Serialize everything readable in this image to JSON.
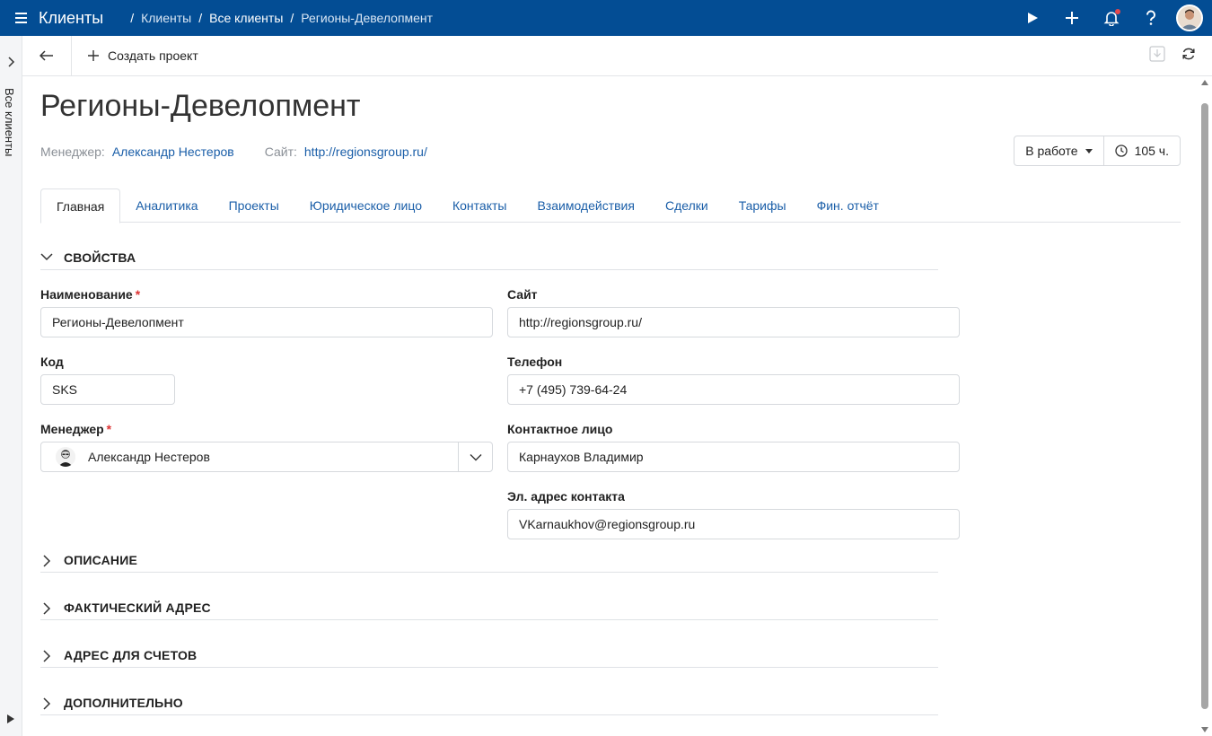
{
  "app": {
    "title": "Клиенты"
  },
  "breadcrumbs": [
    "Клиенты",
    "Все клиенты",
    "Регионы-Девелопмент"
  ],
  "rail": {
    "label": "Все клиенты"
  },
  "toolbar": {
    "create_label": "Создать проект"
  },
  "page": {
    "title": "Регионы-Девелопмент",
    "manager_label": "Менеджер:",
    "manager_value": "Александр Нестеров",
    "site_label": "Сайт:",
    "site_value": "http://regionsgroup.ru/",
    "status": "В работе",
    "hours": "105 ч."
  },
  "tabs": [
    {
      "label": "Главная"
    },
    {
      "label": "Аналитика"
    },
    {
      "label": "Проекты"
    },
    {
      "label": "Юридическое лицо"
    },
    {
      "label": "Контакты"
    },
    {
      "label": "Взаимодействия"
    },
    {
      "label": "Сделки"
    },
    {
      "label": "Тарифы"
    },
    {
      "label": "Фин. отчёт"
    }
  ],
  "sections": {
    "properties": "СВОЙСТВА",
    "description": "ОПИСАНИЕ",
    "actual_address": "ФАКТИЧЕСКИЙ АДРЕС",
    "billing_address": "АДРЕС ДЛЯ СЧЕТОВ",
    "additional": "ДОПОЛНИТЕЛЬНО"
  },
  "form": {
    "name_label": "Наименование",
    "name_value": "Регионы-Девелопмент",
    "code_label": "Код",
    "code_value": "SKS",
    "manager_label": "Менеджер",
    "manager_value": "Александр Нестеров",
    "site_label": "Сайт",
    "site_value": "http://regionsgroup.ru/",
    "phone_label": "Телефон",
    "phone_value": "+7 (495) 739-64-24",
    "contact_label": "Контактное лицо",
    "contact_value": "Карнаухов Владимир",
    "email_label": "Эл. адрес контакта",
    "email_value": "VKarnaukhov@regionsgroup.ru",
    "required_mark": "*"
  },
  "colors": {
    "topbar": "#034d94",
    "link": "#1a5ea8",
    "required": "#dd3333"
  }
}
